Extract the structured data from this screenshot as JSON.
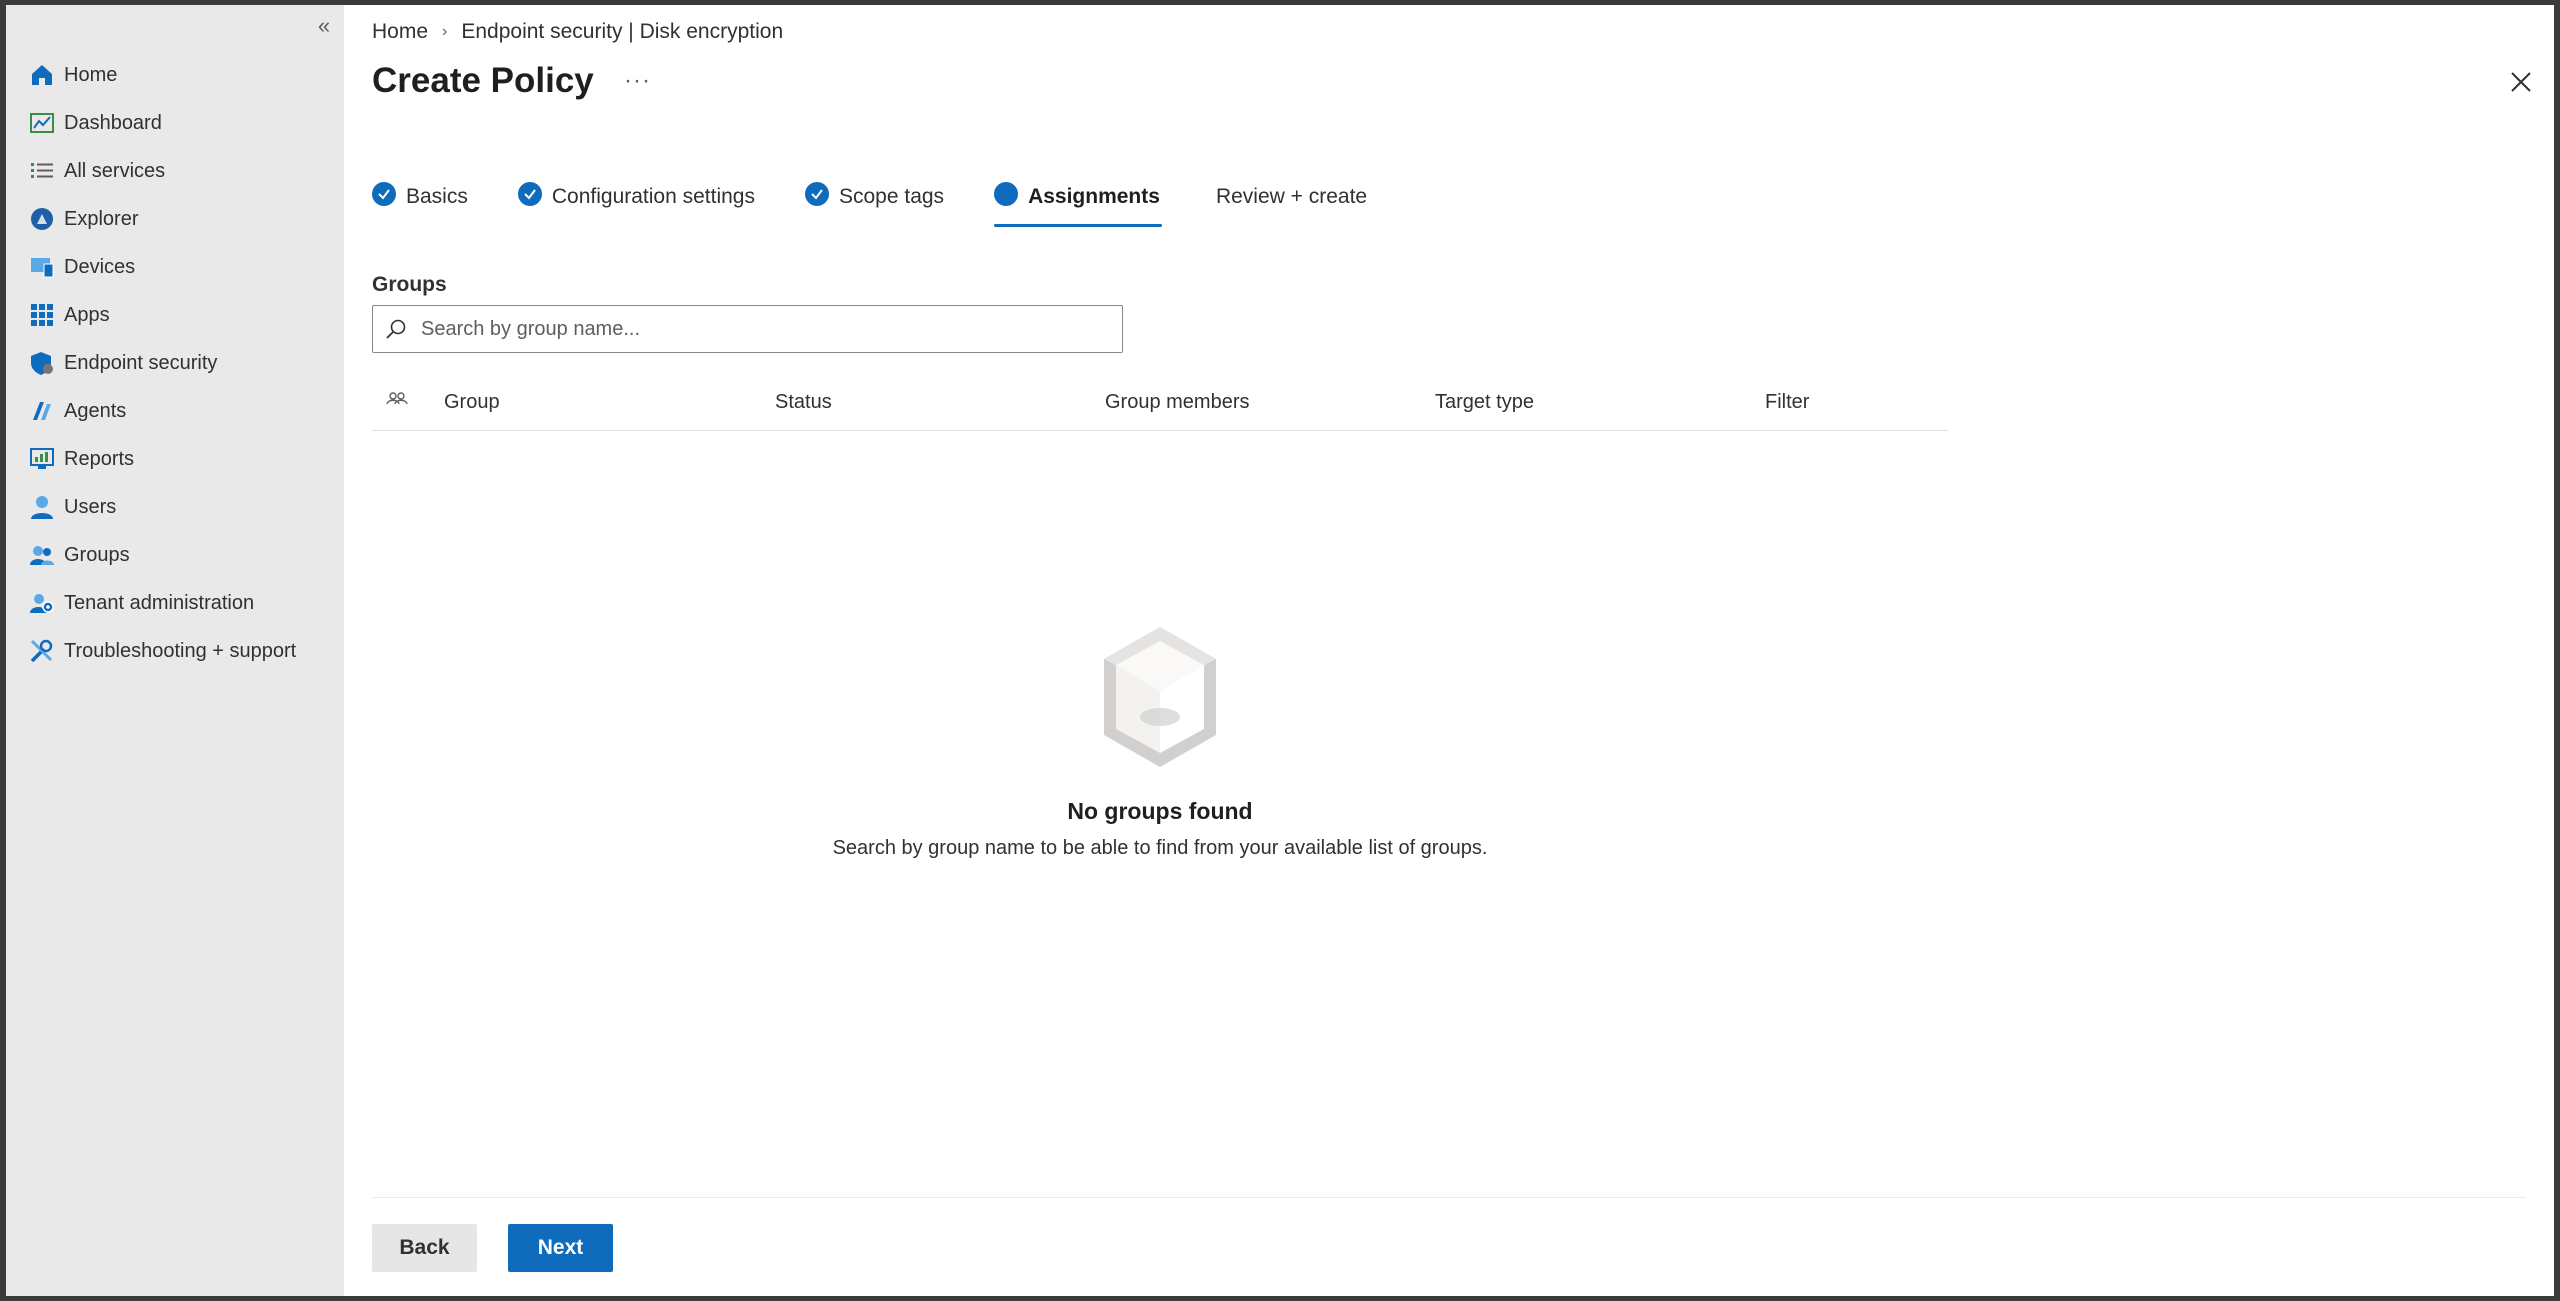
{
  "sidebar": {
    "collapse_label": "«",
    "items": [
      {
        "label": "Home",
        "icon": "home-icon"
      },
      {
        "label": "Dashboard",
        "icon": "dashboard-icon"
      },
      {
        "label": "All services",
        "icon": "list-icon"
      },
      {
        "label": "Explorer",
        "icon": "explorer-icon"
      },
      {
        "label": "Devices",
        "icon": "devices-icon"
      },
      {
        "label": "Apps",
        "icon": "apps-grid-icon"
      },
      {
        "label": "Endpoint security",
        "icon": "shield-icon"
      },
      {
        "label": "Agents",
        "icon": "agents-icon"
      },
      {
        "label": "Reports",
        "icon": "reports-icon"
      },
      {
        "label": "Users",
        "icon": "user-icon"
      },
      {
        "label": "Groups",
        "icon": "groups-icon"
      },
      {
        "label": "Tenant administration",
        "icon": "tenant-admin-icon"
      },
      {
        "label": "Troubleshooting + support",
        "icon": "wrench-icon"
      }
    ]
  },
  "breadcrumb": {
    "home": "Home",
    "current": "Endpoint security | Disk encryption"
  },
  "page": {
    "title": "Create Policy",
    "more": "···"
  },
  "wizard": {
    "steps": [
      {
        "label": "Basics",
        "state": "done"
      },
      {
        "label": "Configuration settings",
        "state": "done"
      },
      {
        "label": "Scope tags",
        "state": "done"
      },
      {
        "label": "Assignments",
        "state": "active"
      },
      {
        "label": "Review + create",
        "state": "pending"
      }
    ]
  },
  "groups": {
    "label": "Groups",
    "search_placeholder": "Search by group name...",
    "columns": [
      "Group",
      "Status",
      "Group members",
      "Target type",
      "Filter"
    ]
  },
  "empty_state": {
    "title": "No groups found",
    "description": "Search by group name to be able to find from your available list of groups."
  },
  "footer": {
    "back_label": "Back",
    "next_label": "Next"
  },
  "colors": {
    "accent": "#0f6cbd",
    "sidebar_bg": "#e9e9e9"
  }
}
